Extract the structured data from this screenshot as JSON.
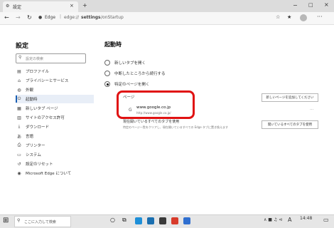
{
  "browser": {
    "tab_title": "設定",
    "tab_close": "×",
    "new_tab": "+",
    "address_site": "Edge",
    "address_path_prefix": "edge://",
    "address_path_main": "settings",
    "address_path_suffix": "/onStartup",
    "window_min": "−",
    "window_max": "□",
    "window_close": "×",
    "colors": {
      "titlebar": "#dcdcdc",
      "accent": "#1a5fb4",
      "highlight": "#e01212"
    }
  },
  "sidebar": {
    "title": "設定",
    "search_placeholder": "設定の検索",
    "items": [
      {
        "label": "プロファイル",
        "icon": "profile-icon"
      },
      {
        "label": "プライバシーとサービス",
        "icon": "lock-icon"
      },
      {
        "label": "外観",
        "icon": "appearance-icon"
      },
      {
        "label": "起動時",
        "icon": "power-icon",
        "active": true
      },
      {
        "label": "新しいタブ ページ",
        "icon": "newtab-icon"
      },
      {
        "label": "サイトのアクセス許可",
        "icon": "permissions-icon"
      },
      {
        "label": "ダウンロード",
        "icon": "download-icon"
      },
      {
        "label": "言語",
        "icon": "language-icon"
      },
      {
        "label": "プリンター",
        "icon": "printer-icon"
      },
      {
        "label": "システム",
        "icon": "system-icon"
      },
      {
        "label": "設定のリセット",
        "icon": "reset-icon"
      },
      {
        "label": "Microsoft Edge について",
        "icon": "edge-logo-icon"
      }
    ]
  },
  "main": {
    "title": "起動時",
    "options": [
      {
        "label": "新しいタブを開く",
        "selected": false
      },
      {
        "label": "中断したところから続行する",
        "selected": false
      },
      {
        "label": "特定のページを開く",
        "selected": true
      }
    ],
    "pages_label": "ページ",
    "add_page_button": "新しいページを追加してください",
    "page_entry": {
      "title": "www.google.co.jp",
      "url": "http://www.google.co.jp/",
      "more": "···"
    },
    "use_open_tabs_title": "現在開いているすべてのタブを使用",
    "use_open_tabs_desc": "特定のページ一覧をクリアし、現在開いているすべての Edge タブに置き換えます",
    "use_open_tabs_button": "開いているすべてのタブを使用"
  },
  "taskbar": {
    "search_placeholder": "ここに入力して検索",
    "time": "14:48",
    "ime_indicator": "A",
    "tray_symbols": "∧ ■ ♫ ⊲",
    "notifications": "▭"
  }
}
